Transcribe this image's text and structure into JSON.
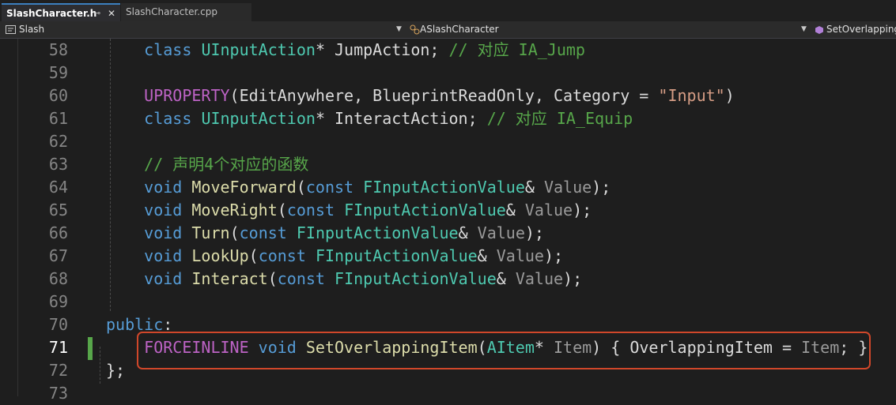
{
  "tabs": {
    "active_label": "SlashCharacter.h",
    "pin_glyph": "⊸",
    "close_glyph": "✕",
    "second_label": "SlashCharacter.cpp"
  },
  "navbar": {
    "project": "Slash",
    "class_scope": "ASlashCharacter",
    "member": "SetOverlappingItem"
  },
  "editor": {
    "line_numbers": [
      "58",
      "59",
      "60",
      "61",
      "62",
      "63",
      "64",
      "65",
      "66",
      "67",
      "68",
      "69",
      "70",
      "71",
      "72",
      "73"
    ],
    "current_line": "71",
    "lines": [
      [
        {
          "t": "    "
        },
        {
          "t": "class",
          "c": "kw"
        },
        {
          "t": " "
        },
        {
          "t": "UInputAction",
          "c": "ty"
        },
        {
          "t": "* JumpAction; ",
          "c": "var"
        },
        {
          "t": "// 对应 IA_Jump",
          "c": "cm"
        }
      ],
      [],
      [
        {
          "t": "    "
        },
        {
          "t": "UPROPERTY",
          "c": "mac"
        },
        {
          "t": "(EditAnywhere, BlueprintReadOnly, Category = ",
          "c": "var"
        },
        {
          "t": "\"Input\"",
          "c": "st"
        },
        {
          "t": ")",
          "c": "var"
        }
      ],
      [
        {
          "t": "    "
        },
        {
          "t": "class",
          "c": "kw"
        },
        {
          "t": " "
        },
        {
          "t": "UInputAction",
          "c": "ty"
        },
        {
          "t": "* InteractAction; ",
          "c": "var"
        },
        {
          "t": "// 对应 IA_Equip",
          "c": "cm"
        }
      ],
      [],
      [
        {
          "t": "    "
        },
        {
          "t": "// 声明4个对应的函数",
          "c": "cm"
        }
      ],
      [
        {
          "t": "    "
        },
        {
          "t": "void",
          "c": "kw"
        },
        {
          "t": " "
        },
        {
          "t": "MoveForward",
          "c": "fn"
        },
        {
          "t": "(",
          "c": "var"
        },
        {
          "t": "const",
          "c": "kw"
        },
        {
          "t": " "
        },
        {
          "t": "FInputActionValue",
          "c": "ty"
        },
        {
          "t": "& ",
          "c": "var"
        },
        {
          "t": "Value",
          "c": "prm"
        },
        {
          "t": ");",
          "c": "var"
        }
      ],
      [
        {
          "t": "    "
        },
        {
          "t": "void",
          "c": "kw"
        },
        {
          "t": " "
        },
        {
          "t": "MoveRight",
          "c": "fn"
        },
        {
          "t": "(",
          "c": "var"
        },
        {
          "t": "const",
          "c": "kw"
        },
        {
          "t": " "
        },
        {
          "t": "FInputActionValue",
          "c": "ty"
        },
        {
          "t": "& ",
          "c": "var"
        },
        {
          "t": "Value",
          "c": "prm"
        },
        {
          "t": ");",
          "c": "var"
        }
      ],
      [
        {
          "t": "    "
        },
        {
          "t": "void",
          "c": "kw"
        },
        {
          "t": " "
        },
        {
          "t": "Turn",
          "c": "fn"
        },
        {
          "t": "(",
          "c": "var"
        },
        {
          "t": "const",
          "c": "kw"
        },
        {
          "t": " "
        },
        {
          "t": "FInputActionValue",
          "c": "ty"
        },
        {
          "t": "& ",
          "c": "var"
        },
        {
          "t": "Value",
          "c": "prm"
        },
        {
          "t": ");",
          "c": "var"
        }
      ],
      [
        {
          "t": "    "
        },
        {
          "t": "void",
          "c": "kw"
        },
        {
          "t": " "
        },
        {
          "t": "LookUp",
          "c": "fn"
        },
        {
          "t": "(",
          "c": "var"
        },
        {
          "t": "const",
          "c": "kw"
        },
        {
          "t": " "
        },
        {
          "t": "FInputActionValue",
          "c": "ty"
        },
        {
          "t": "& ",
          "c": "var"
        },
        {
          "t": "Value",
          "c": "prm"
        },
        {
          "t": ");",
          "c": "var"
        }
      ],
      [
        {
          "t": "    "
        },
        {
          "t": "void",
          "c": "kw"
        },
        {
          "t": " "
        },
        {
          "t": "Interact",
          "c": "fn"
        },
        {
          "t": "(",
          "c": "var"
        },
        {
          "t": "const",
          "c": "kw"
        },
        {
          "t": " "
        },
        {
          "t": "FInputActionValue",
          "c": "ty"
        },
        {
          "t": "& ",
          "c": "var"
        },
        {
          "t": "Value",
          "c": "prm"
        },
        {
          "t": ");",
          "c": "var"
        }
      ],
      [],
      [
        {
          "t": "public",
          "c": "kw"
        },
        {
          "t": ":",
          "c": "var"
        }
      ],
      [
        {
          "t": "    "
        },
        {
          "t": "FORCEINLINE",
          "c": "mac"
        },
        {
          "t": " "
        },
        {
          "t": "void",
          "c": "kw"
        },
        {
          "t": " "
        },
        {
          "t": "SetOverlappingItem",
          "c": "fn"
        },
        {
          "t": "(",
          "c": "var"
        },
        {
          "t": "AItem",
          "c": "ty"
        },
        {
          "t": "* ",
          "c": "var"
        },
        {
          "t": "Item",
          "c": "prm"
        },
        {
          "t": ") { OverlappingItem = ",
          "c": "var"
        },
        {
          "t": "Item",
          "c": "prm"
        },
        {
          "t": "; }",
          "c": "var"
        }
      ],
      [
        {
          "t": "};",
          "c": "var"
        }
      ],
      []
    ]
  },
  "colors": {
    "background": "#1e1e1e",
    "highlight_box": "#d0472a",
    "change_marker": "#57a64a"
  }
}
